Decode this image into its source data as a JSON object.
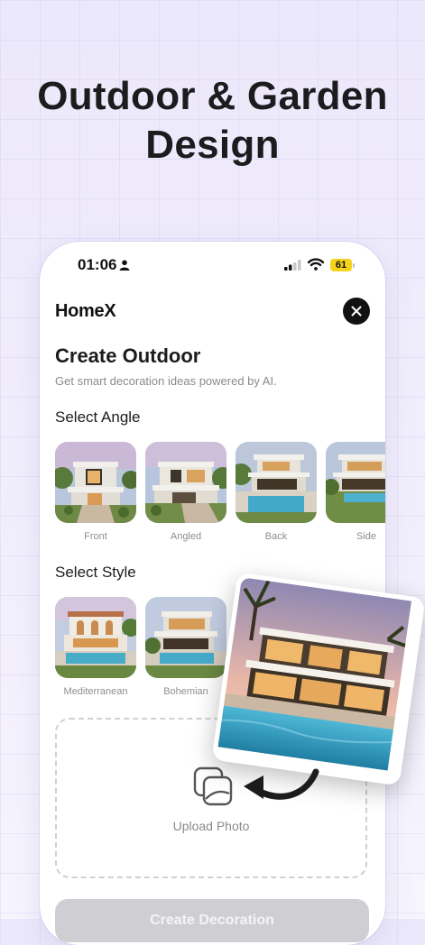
{
  "headline": {
    "line1": "Outdoor & Garden",
    "line2": "Design"
  },
  "status_bar": {
    "time": "01:06",
    "battery": "61"
  },
  "app": {
    "name": "HomeX"
  },
  "create_outdoor": {
    "title": "Create Outdoor",
    "subtitle": "Get smart decoration ideas powered by AI."
  },
  "select_angle": {
    "title": "Select Angle",
    "options": [
      {
        "label": "Front"
      },
      {
        "label": "Angled"
      },
      {
        "label": "Back"
      },
      {
        "label": "Side"
      }
    ]
  },
  "select_style": {
    "title": "Select Style",
    "options": [
      {
        "label": "Mediterranean"
      },
      {
        "label": "Bohemian"
      }
    ]
  },
  "upload": {
    "label": "Upload Photo"
  },
  "create_button": {
    "label": "Create Decoration"
  },
  "colors": {
    "background": "#ece8fb",
    "accent_dark": "#111111",
    "battery": "#f5d21b",
    "button_disabled": "#cfcfd3"
  }
}
